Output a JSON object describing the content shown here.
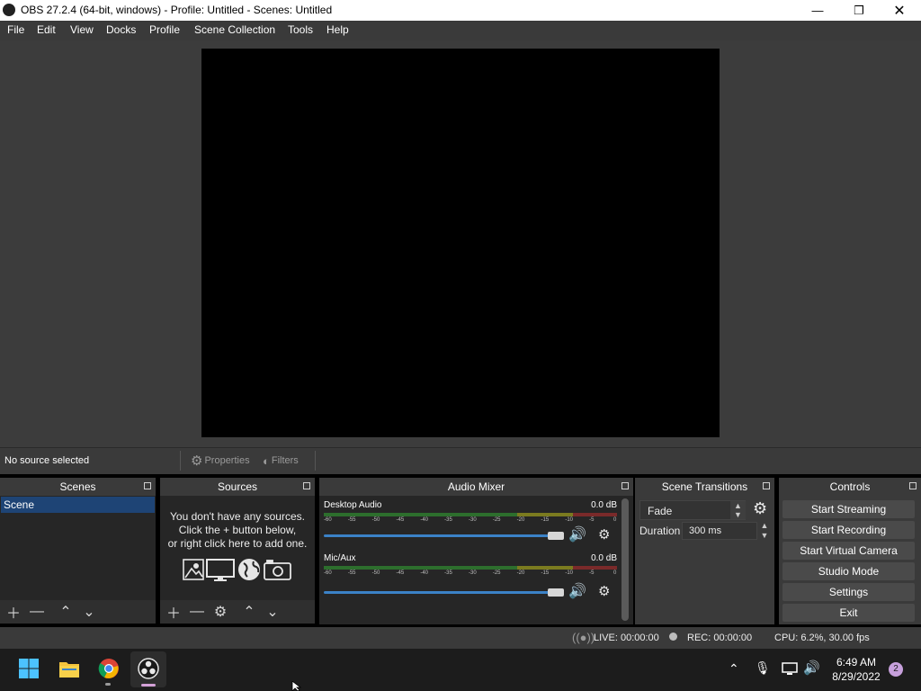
{
  "window": {
    "title": "OBS 27.2.4 (64-bit, windows) - Profile: Untitled - Scenes: Untitled"
  },
  "menu": [
    "File",
    "Edit",
    "View",
    "Docks",
    "Profile",
    "Scene Collection",
    "Tools",
    "Help"
  ],
  "source_toolbar": {
    "status": "No source selected",
    "properties": "Properties",
    "filters": "Filters"
  },
  "docks": {
    "scenes": {
      "title": "Scenes",
      "items": [
        "Scene"
      ]
    },
    "sources": {
      "title": "Sources",
      "empty_line1": "You don't have any sources.",
      "empty_line2": "Click the + button below,",
      "empty_line3": "or right click here to add one."
    },
    "audio_mixer": {
      "title": "Audio Mixer",
      "tracks": [
        {
          "name": "Desktop Audio",
          "db": "0.0 dB",
          "volume": 1.0
        },
        {
          "name": "Mic/Aux",
          "db": "0.0 dB",
          "volume": 1.0
        }
      ],
      "ticks": [
        "-60",
        "-55",
        "-50",
        "-45",
        "-40",
        "-35",
        "-30",
        "-25",
        "-20",
        "-15",
        "-10",
        "-5",
        "0"
      ]
    },
    "transitions": {
      "title": "Scene Transitions",
      "selected": "Fade",
      "duration_label": "Duration",
      "duration_value": "300 ms"
    },
    "controls": {
      "title": "Controls",
      "buttons": [
        "Start Streaming",
        "Start Recording",
        "Start Virtual Camera",
        "Studio Mode",
        "Settings",
        "Exit"
      ]
    }
  },
  "status": {
    "live": "LIVE: 00:00:00",
    "rec": "REC: 00:00:00",
    "cpu": "CPU: 6.2%, 30.00 fps"
  },
  "taskbar": {
    "time": "6:49 AM",
    "date": "8/29/2022",
    "notifications": "2"
  },
  "colors": {
    "accent": "#3b82c7",
    "selection": "#1e4475"
  }
}
